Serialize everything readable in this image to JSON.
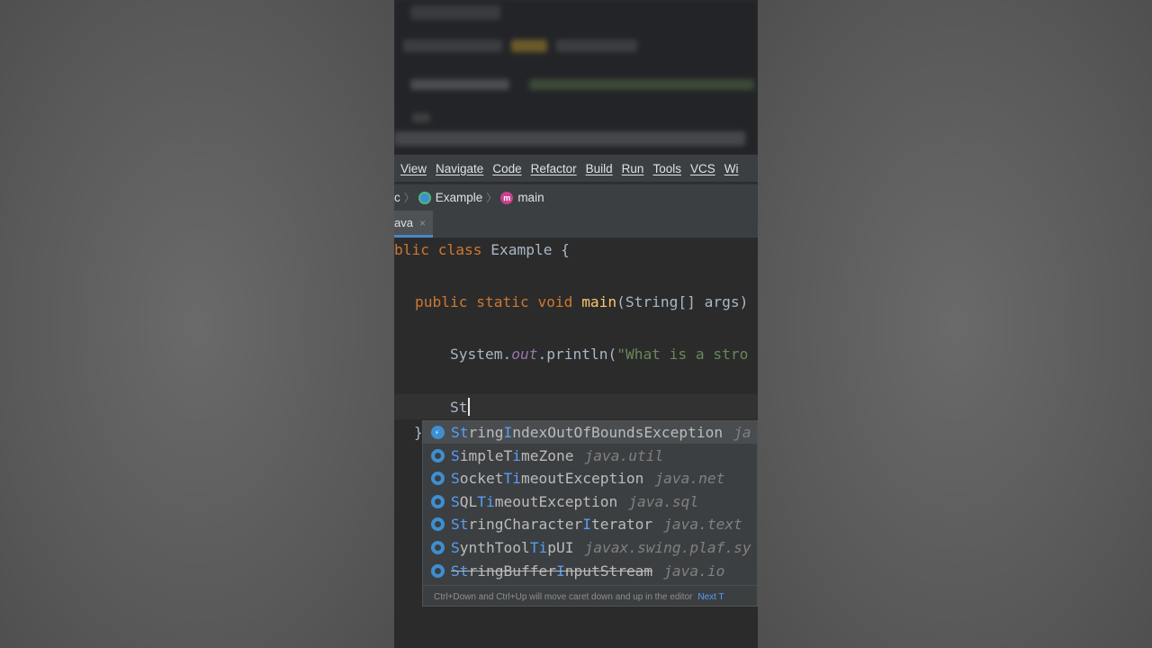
{
  "menu": [
    "View",
    "Navigate",
    "Code",
    "Refactor",
    "Build",
    "Run",
    "Tools",
    "VCS",
    "Wi"
  ],
  "breadcrumb": {
    "prefix": "c",
    "class_name": "Example",
    "method_name": "main",
    "method_icon_letter": "m"
  },
  "tab": {
    "label": "ava",
    "close": "×"
  },
  "code": {
    "line1_kw": "blic class",
    "line1_rest": " Example {",
    "line2_kw": "public static void",
    "line2_fn": "main",
    "line2_rest": "(String[] args)",
    "line3_a": "System.",
    "line3_out": "out",
    "line3_b": ".println(",
    "line3_str": "\"What is a stro",
    "line4_typed": "St",
    "brace": "}"
  },
  "completion": {
    "items": [
      {
        "parts": [
          [
            "St",
            "m"
          ],
          [
            "ring",
            "n"
          ],
          [
            "I",
            "m"
          ],
          [
            "ndexOutOfBoundsException",
            "n"
          ]
        ],
        "package": "ja",
        "icon": "exception-class-icon",
        "deprecated": false
      },
      {
        "parts": [
          [
            "S",
            "m"
          ],
          [
            "impleT",
            "n"
          ],
          [
            "i",
            "m"
          ],
          [
            "meZone",
            "n"
          ]
        ],
        "package": "java.util",
        "icon": "class-icon",
        "deprecated": false
      },
      {
        "parts": [
          [
            "S",
            "m"
          ],
          [
            "ocket",
            "n"
          ],
          [
            "Ti",
            "m"
          ],
          [
            "meoutException",
            "n"
          ]
        ],
        "package": "java.net",
        "icon": "class-icon",
        "deprecated": false
      },
      {
        "parts": [
          [
            "S",
            "m"
          ],
          [
            "QL",
            "n"
          ],
          [
            "Ti",
            "m"
          ],
          [
            "meoutException",
            "n"
          ]
        ],
        "package": "java.sql",
        "icon": "class-icon",
        "deprecated": false
      },
      {
        "parts": [
          [
            "St",
            "m"
          ],
          [
            "ringCharacter",
            "n"
          ],
          [
            "I",
            "m"
          ],
          [
            "terator",
            "n"
          ]
        ],
        "package": "java.text",
        "icon": "class-icon",
        "deprecated": false
      },
      {
        "parts": [
          [
            "S",
            "m"
          ],
          [
            "ynthTool",
            "n"
          ],
          [
            "Ti",
            "m"
          ],
          [
            "pUI",
            "n"
          ]
        ],
        "package": "javax.swing.plaf.sy",
        "icon": "class-icon",
        "deprecated": false
      },
      {
        "parts": [
          [
            "St",
            "m"
          ],
          [
            "ringBuffer",
            "n"
          ],
          [
            "I",
            "m"
          ],
          [
            "nputStream",
            "n"
          ]
        ],
        "package": "java.io",
        "icon": "class-icon",
        "deprecated": true
      }
    ],
    "hint": "Ctrl+Down and Ctrl+Up will move caret down and up in the editor",
    "hint_link": "Next T"
  },
  "colors": {
    "keyword": "#cc7832",
    "function": "#ffc66d",
    "string": "#6a8759",
    "match": "#589df6",
    "accent": "#4a88c7"
  }
}
